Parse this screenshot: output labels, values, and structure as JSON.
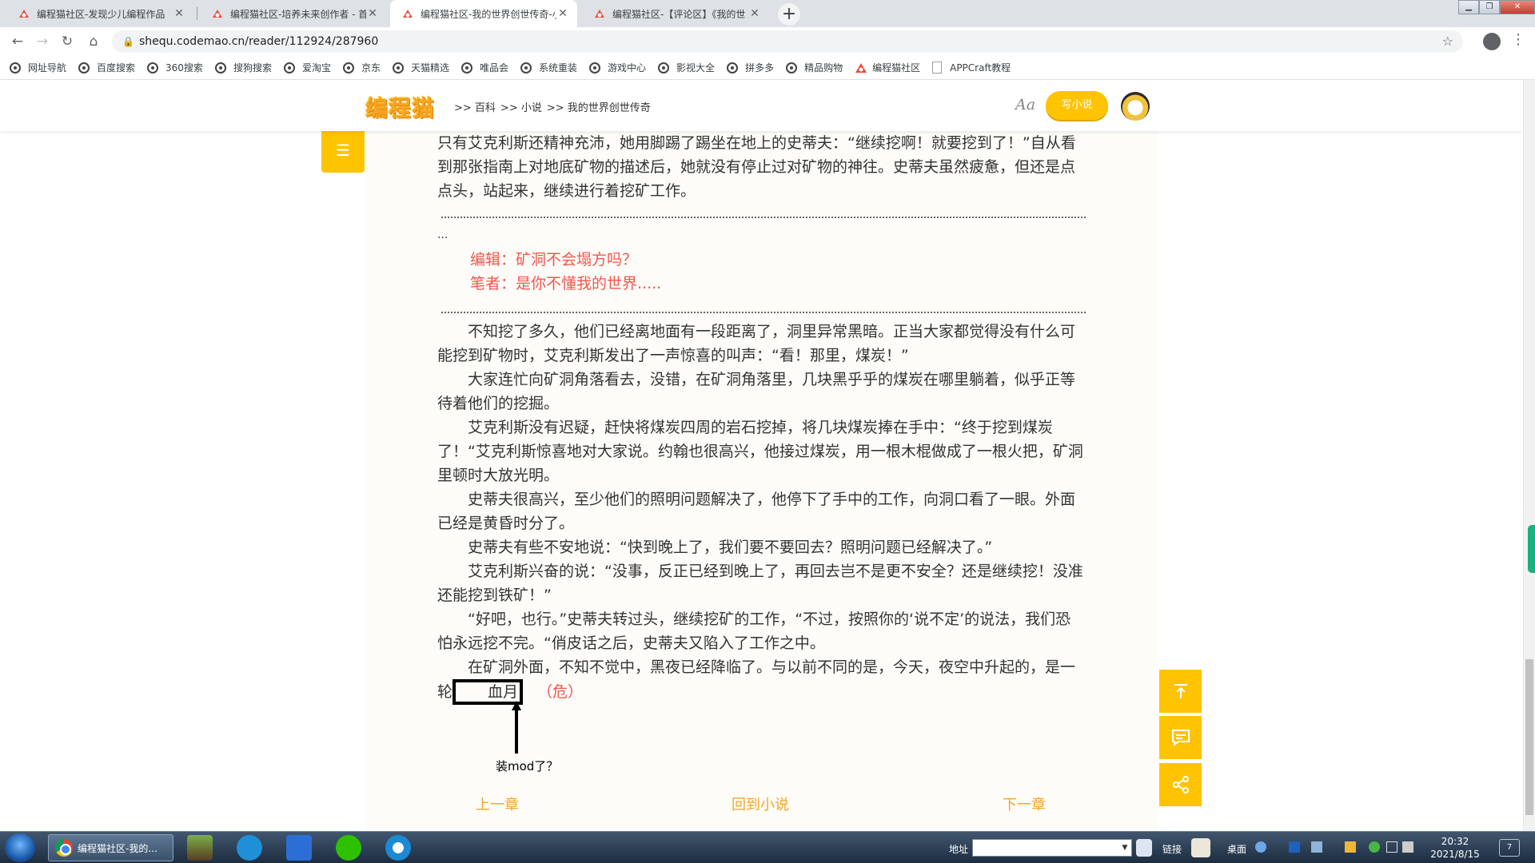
{
  "browser": {
    "tabs": [
      {
        "title": "编程猫社区-发现少儿编程作品",
        "active": false
      },
      {
        "title": "编程猫社区-培养未来创作者 - 首",
        "active": false
      },
      {
        "title": "编程猫社区-我的世界创世传奇-小",
        "active": true
      },
      {
        "title": "编程猫社区-【评论区】《我的世",
        "active": false
      }
    ],
    "url": "shequ.codemao.cn/reader/112924/287960",
    "bookmarks": [
      {
        "label": "网址导航",
        "icon": "globe-icon"
      },
      {
        "label": "百度搜索",
        "icon": "globe-icon"
      },
      {
        "label": "360搜索",
        "icon": "globe-icon"
      },
      {
        "label": "搜狗搜索",
        "icon": "globe-icon"
      },
      {
        "label": "爱淘宝",
        "icon": "globe-icon"
      },
      {
        "label": "京东",
        "icon": "globe-icon"
      },
      {
        "label": "天猫精选",
        "icon": "globe-icon"
      },
      {
        "label": "唯品会",
        "icon": "globe-icon"
      },
      {
        "label": "系统重装",
        "icon": "globe-icon"
      },
      {
        "label": "游戏中心",
        "icon": "globe-icon"
      },
      {
        "label": "影视大全",
        "icon": "globe-icon"
      },
      {
        "label": "拼多多",
        "icon": "globe-icon"
      },
      {
        "label": "精品购物",
        "icon": "globe-icon"
      },
      {
        "label": "编程猫社区",
        "icon": "codemao-icon"
      },
      {
        "label": "APPCraft教程",
        "icon": "page-icon"
      }
    ]
  },
  "site": {
    "logo": "编程猫",
    "breadcrumb": [
      ">> 百科",
      ">> 小说",
      ">> 我的世界创世传奇"
    ],
    "font_toggle": "Aa",
    "write_button": "写小说"
  },
  "content": {
    "top_paragraph": "只有艾克利斯还精神充沛，她用脚踢了踢坐在地上的史蒂夫：“继续挖啊！就要挖到了！”自从看到那张指南上对地底矿物的描述后，她就没有停止过对矿物的神往。史蒂夫虽然疲惫，但还是点点头，站起来，继续进行着挖矿工作。",
    "ellipsis": "...",
    "editor_line": "编辑：矿洞不会塌方吗？",
    "author_line": "笔者：是你不懂我的世界.....",
    "paragraphs": [
      "不知挖了多久，他们已经离地面有一段距离了，洞里异常黑暗。正当大家都觉得没有什么可能挖到矿物时，艾克利斯发出了一声惊喜的叫声：“看！那里，煤炭！”",
      "大家连忙向矿洞角落看去，没错，在矿洞角落里，几块黑乎乎的煤炭在哪里躺着，似乎正等待着他们的挖掘。",
      "艾克利斯没有迟疑，赶快将煤炭四周的岩石挖掉，将几块煤炭捧在手中：“终于挖到煤炭了！“艾克利斯惊喜地对大家说。约翰也很高兴，他接过煤炭，用一根木棍做成了一根火把，矿洞里顿时大放光明。",
      "史蒂夫很高兴，至少他们的照明问题解决了，他停下了手中的工作，向洞口看了一眼。外面已经是黄昏时分了。",
      "史蒂夫有些不安地说：“快到晚上了，我们要不要回去？照明问题已经解决了。”",
      "艾克利斯兴奋的说：“没事，反正已经到晚上了，再回去岂不是更不安全？还是继续挖！没准还能挖到铁矿！”",
      "“好吧，也行。”史蒂夫转过头，继续挖矿的工作，“不过，按照你的‘说不定’的说法，我们恐怕永远挖不完。“俏皮话之后，史蒂夫又陷入了工作之中。"
    ],
    "last_paragraph_start": "在矿洞外面，不知不觉中，黑夜已经降临了。与以前不同的是，今天，夜空中升起的，是一轮",
    "highlight_word": "血月",
    "danger_tag": "（危）",
    "annotation": "装mod了？"
  },
  "chapter_nav": {
    "prev": "上一章",
    "back": "回到小说",
    "next": "下一章"
  },
  "taskbar": {
    "active_window": "编程猫社区-我的...",
    "address_label": "地址",
    "links_label": "链接",
    "desktop_label": "桌面",
    "time": "20:32",
    "date": "2021/8/15",
    "notification_count": "7"
  },
  "colors": {
    "accent": "#ffc300",
    "chapter_nav": "#f5a623",
    "red_text": "#f2554d",
    "reader_bg": "#fdfcf8"
  }
}
